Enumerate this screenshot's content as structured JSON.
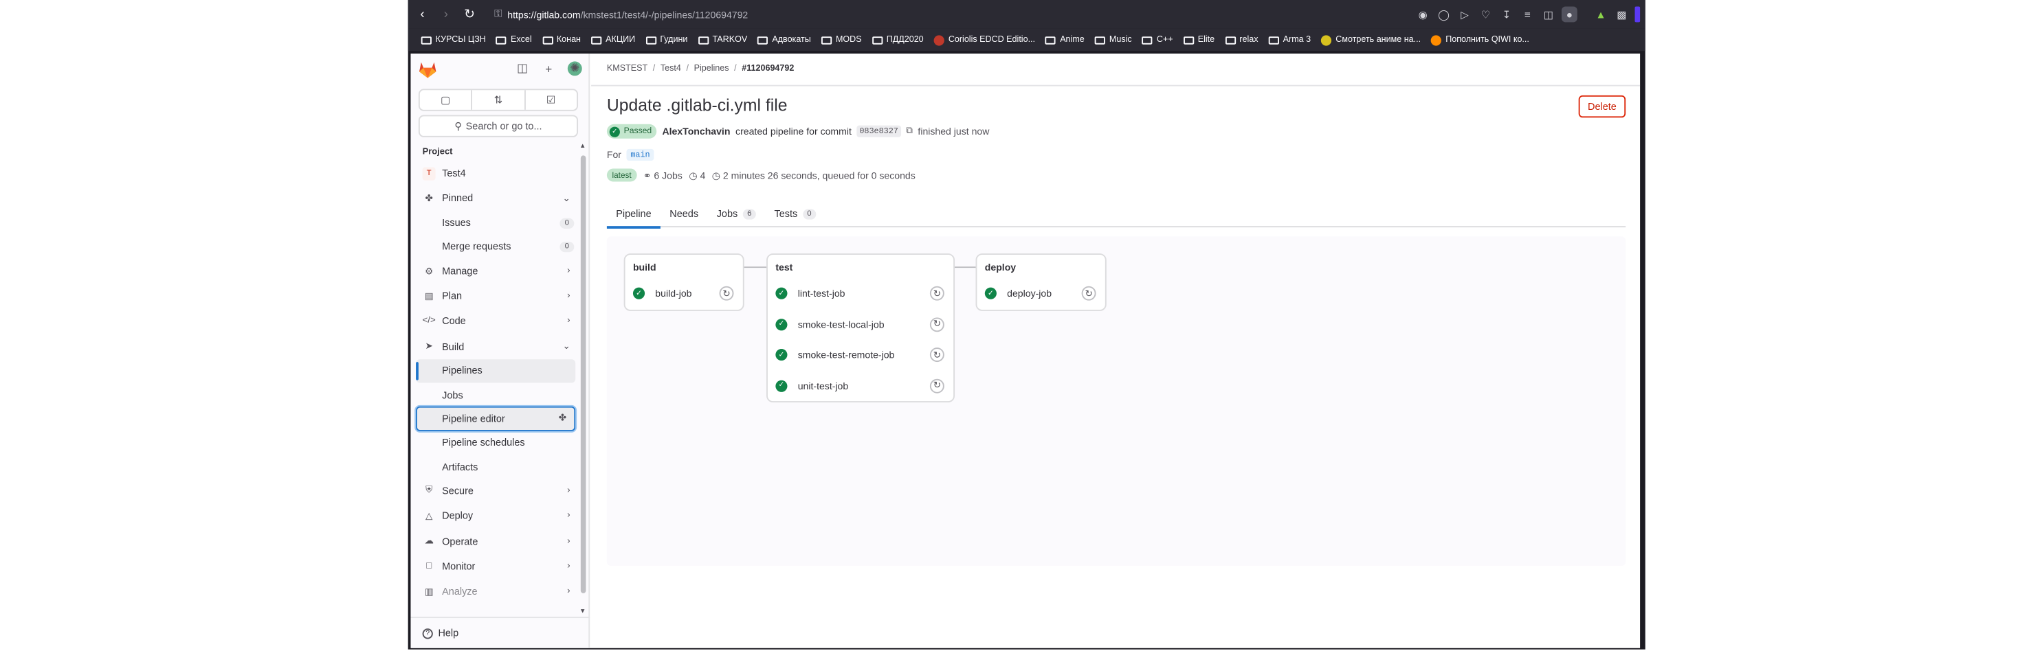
{
  "browser": {
    "url_host": "https://gitlab.com",
    "url_path": "/kmstest1/test4/-/pipelines/1120694792",
    "bookmarks": [
      "КУРСЫ ЦЗН",
      "Excel",
      "Конан",
      "АКЦИИ",
      "Гудини",
      "TARKOV",
      "Адвокаты",
      "MODS",
      "ПДД2020",
      "Coriolis EDCD Editio...",
      "Anime",
      "Music",
      "C++",
      "Elite",
      "relax",
      "Arma 3",
      "Смотреть аниме на...",
      "Пополнить QIWI ко..."
    ]
  },
  "sidebar": {
    "search_label": "Search or go to...",
    "section_project": "Project",
    "project_initial": "T",
    "project_name": "Test4",
    "pinned_label": "Pinned",
    "items": {
      "issues": "Issues",
      "issues_count": "0",
      "merge_requests": "Merge requests",
      "mr_count": "0",
      "manage": "Manage",
      "plan": "Plan",
      "code": "Code",
      "build": "Build",
      "pipelines": "Pipelines",
      "jobs": "Jobs",
      "pipeline_editor": "Pipeline editor",
      "pipeline_schedules": "Pipeline schedules",
      "artifacts": "Artifacts",
      "secure": "Secure",
      "deploy": "Deploy",
      "operate": "Operate",
      "monitor": "Monitor",
      "analyze": "Analyze"
    },
    "help_label": "Help"
  },
  "breadcrumb": {
    "group": "KMSTEST",
    "project": "Test4",
    "section": "Pipelines",
    "current": "#1120694792"
  },
  "pipeline": {
    "title": "Update .gitlab-ci.yml file",
    "delete_label": "Delete",
    "status": "Passed",
    "author": "AlexTonchavin",
    "created_text": "created pipeline for commit",
    "commit_sha": "083e8327",
    "finished_text": "finished just now",
    "for_label": "For",
    "branch": "main",
    "latest_badge": "latest",
    "jobs_count_label": "6 Jobs",
    "stages_count": "4",
    "duration_text": "2 minutes 26 seconds, queued for 0 seconds"
  },
  "tabs": [
    {
      "label": "Pipeline",
      "count": null
    },
    {
      "label": "Needs",
      "count": null
    },
    {
      "label": "Jobs",
      "count": "6"
    },
    {
      "label": "Tests",
      "count": "0"
    }
  ],
  "stages": [
    {
      "name": "build",
      "jobs": [
        "build-job"
      ]
    },
    {
      "name": "test",
      "jobs": [
        "lint-test-job",
        "smoke-test-local-job",
        "smoke-test-remote-job",
        "unit-test-job"
      ]
    },
    {
      "name": "deploy",
      "jobs": [
        "deploy-job"
      ]
    }
  ],
  "colors": {
    "accent": "#1f75cb",
    "success": "#108548",
    "danger": "#dd2b0e"
  }
}
